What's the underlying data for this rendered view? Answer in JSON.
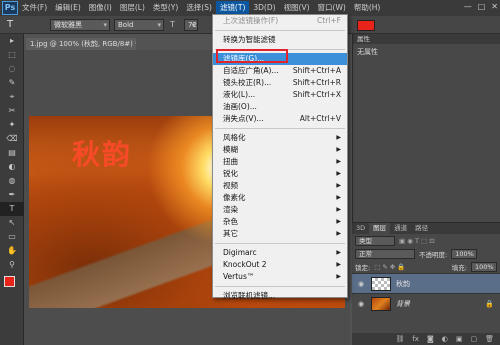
{
  "app": {
    "logo": "Ps"
  },
  "menubar": {
    "items": [
      "文件(F)",
      "编辑(E)",
      "图像(I)",
      "图层(L)",
      "类型(Y)",
      "选择(S)",
      "滤镜(T)",
      "3D(D)",
      "视图(V)",
      "窗口(W)",
      "帮助(H)"
    ],
    "active": "滤镜(T)",
    "window_controls": [
      "—",
      "□",
      "✕"
    ]
  },
  "options_bar": {
    "tool_icon": "T",
    "font_family": "微软雅黑",
    "font_style": "Bold",
    "font_size": "72"
  },
  "colors": {
    "text_color_swatch": "#e8231a",
    "menu_highlight": "#3c8fd9",
    "annotation_box": "#e0242b"
  },
  "document_tab": "1.jpg @ 100% (秋韵, RGB/8#) *",
  "canvas": {
    "overlay_text": "秋韵"
  },
  "tools": [
    "▸",
    "⬚",
    "◌",
    "✎",
    "⌖",
    "✂",
    "✦",
    "⌫",
    "▤",
    "◐",
    "◍",
    "✒",
    "T",
    "↖",
    "▭",
    "✋",
    "⚲"
  ],
  "properties_panel": {
    "title": "属性",
    "content": "无属性"
  },
  "layers_panel": {
    "tabs": [
      "3D",
      "图层",
      "通道",
      "路径"
    ],
    "filter_label": "类型",
    "blend_mode": "正常",
    "opacity_label": "不透明度:",
    "opacity_value": "100%",
    "lock_label": "锁定:",
    "fill_label": "填充:",
    "fill_value": "100%",
    "layers": [
      {
        "name": "秋韵",
        "type": "text",
        "selected": true
      },
      {
        "name": "背景",
        "type": "image",
        "selected": false,
        "locked": true
      }
    ],
    "bottom_icons": [
      "⛓",
      "fx",
      "◙",
      "◐",
      "▣",
      "▢",
      "🗑"
    ]
  },
  "filter_menu": {
    "items": [
      {
        "label": "上次滤镜操作(F)",
        "shortcut": "Ctrl+F",
        "disabled": true
      },
      {
        "sep": true
      },
      {
        "label": "转换为智能滤镜"
      },
      {
        "sep": true
      },
      {
        "label": "滤镜库(G)...",
        "highlight": true
      },
      {
        "label": "自适应广角(A)...",
        "shortcut": "Shift+Ctrl+A"
      },
      {
        "label": "镜头校正(R)...",
        "shortcut": "Shift+Ctrl+R"
      },
      {
        "label": "液化(L)...",
        "shortcut": "Shift+Ctrl+X"
      },
      {
        "label": "油画(O)..."
      },
      {
        "label": "消失点(V)...",
        "shortcut": "Alt+Ctrl+V"
      },
      {
        "sep": true
      },
      {
        "label": "风格化",
        "submenu": true
      },
      {
        "label": "模糊",
        "submenu": true
      },
      {
        "label": "扭曲",
        "submenu": true
      },
      {
        "label": "锐化",
        "submenu": true
      },
      {
        "label": "视频",
        "submenu": true
      },
      {
        "label": "像素化",
        "submenu": true
      },
      {
        "label": "渲染",
        "submenu": true
      },
      {
        "label": "杂色",
        "submenu": true
      },
      {
        "label": "其它",
        "submenu": true
      },
      {
        "sep": true
      },
      {
        "label": "Digimarc",
        "submenu": true
      },
      {
        "label": "KnockOut 2",
        "submenu": true
      },
      {
        "label": "Vertus™",
        "submenu": true
      },
      {
        "sep": true
      },
      {
        "label": "浏览联机滤镜..."
      }
    ]
  }
}
